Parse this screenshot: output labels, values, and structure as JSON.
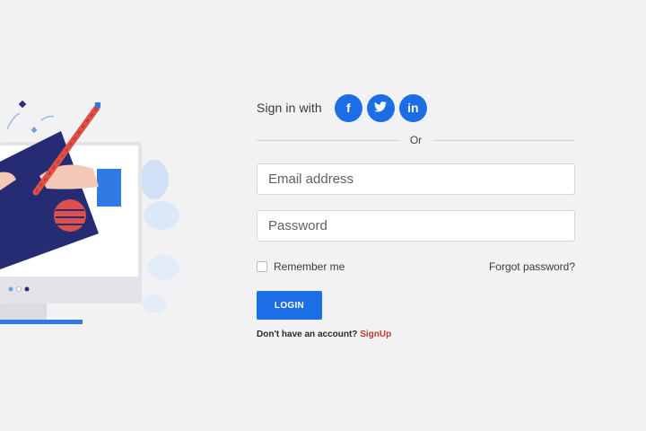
{
  "social": {
    "label": "Sign in with",
    "buttons": [
      {
        "icon": "facebook-icon",
        "glyph": "f"
      },
      {
        "icon": "twitter-icon",
        "glyph": "t"
      },
      {
        "icon": "linkedin-icon",
        "glyph": "in"
      }
    ]
  },
  "divider": {
    "text": "Or"
  },
  "email": {
    "placeholder": "Email address"
  },
  "password": {
    "placeholder": "Password"
  },
  "remember": {
    "label": "Remember me"
  },
  "forgot": {
    "label": "Forgot password?"
  },
  "login": {
    "label": "LOGIN"
  },
  "signup": {
    "prompt": "Don't have an account?",
    "link": "SignUp"
  },
  "colors": {
    "accent": "#1b6ee6",
    "signup_link": "#c0392b",
    "background": "#f2f2f5"
  }
}
